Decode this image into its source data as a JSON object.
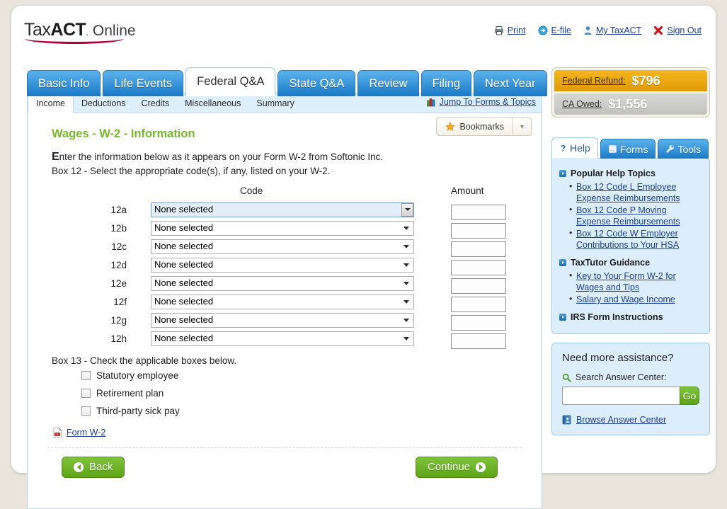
{
  "brand": {
    "logo_tax": "Tax",
    "logo_act": "ACT",
    "logo_online": "Online"
  },
  "top_links": [
    {
      "label": "Print",
      "icon": "printer-icon"
    },
    {
      "label": "E-file",
      "icon": "efile-icon"
    },
    {
      "label": "My TaxACT",
      "icon": "user-icon"
    },
    {
      "label": "Sign Out",
      "icon": "close-x-icon"
    }
  ],
  "tabs": [
    {
      "label": "Basic Info",
      "active": false
    },
    {
      "label": "Life Events",
      "active": false
    },
    {
      "label": "Federal Q&A",
      "active": true
    },
    {
      "label": "State Q&A",
      "active": false
    },
    {
      "label": "Review",
      "active": false
    },
    {
      "label": "Filing",
      "active": false
    },
    {
      "label": "Next Year",
      "active": false
    }
  ],
  "subtabs": [
    {
      "label": "Income",
      "active": true
    },
    {
      "label": "Deductions",
      "active": false
    },
    {
      "label": "Credits",
      "active": false
    },
    {
      "label": "Miscellaneous",
      "active": false
    },
    {
      "label": "Summary",
      "active": false
    }
  ],
  "jump_link": {
    "label": "Jump To Forms & Topics",
    "icon": "books-icon"
  },
  "main": {
    "page_title": "Wages - W-2 - Information",
    "bookmarks_label": "Bookmarks",
    "intro_first_letter": "E",
    "intro_line1_rest": "nter the information below as it appears on your Form W-2 from Softonic Inc.",
    "intro_line2": "Box 12 - Select the appropriate code(s), if any, listed on your W-2.",
    "col_code": "Code",
    "col_amount": "Amount",
    "rows": [
      {
        "label": "12a",
        "code_value": "None selected",
        "amount_value": "",
        "focused": true
      },
      {
        "label": "12b",
        "code_value": "None selected",
        "amount_value": "",
        "focused": false
      },
      {
        "label": "12c",
        "code_value": "None selected",
        "amount_value": "",
        "focused": false
      },
      {
        "label": "12d",
        "code_value": "None selected",
        "amount_value": "",
        "focused": false
      },
      {
        "label": "12e",
        "code_value": "None selected",
        "amount_value": "",
        "focused": false
      },
      {
        "label": "12f",
        "code_value": "None selected",
        "amount_value": "",
        "focused": false
      },
      {
        "label": "12g",
        "code_value": "None selected",
        "amount_value": "",
        "focused": false
      },
      {
        "label": "12h",
        "code_value": "None selected",
        "amount_value": "",
        "focused": false
      }
    ],
    "box13_label": "Box 13 - Check the applicable boxes below.",
    "checkboxes": [
      {
        "label": "Statutory employee",
        "checked": false
      },
      {
        "label": "Retirement plan",
        "checked": false
      },
      {
        "label": "Third-party sick pay",
        "checked": false
      }
    ],
    "form_link": "Form W-2",
    "back_label": "Back",
    "continue_label": "Continue"
  },
  "refund": {
    "federal_label": "Federal Refund:",
    "federal_amount": "$796",
    "state_label": "CA Owed:",
    "state_amount": "$1,556",
    "federal_color": "#e6a50a",
    "state_color": "#c9c9c6"
  },
  "rail_tabs": [
    {
      "label": "Help",
      "icon": "question-icon",
      "active": true
    },
    {
      "label": "Forms",
      "icon": "document-icon",
      "active": false
    },
    {
      "label": "Tools",
      "icon": "wrench-icon",
      "active": false
    }
  ],
  "help": {
    "sections": [
      {
        "title": "Popular Help Topics",
        "links": [
          "Box 12 Code L Employee Expense Reimbursements",
          "Box 12 Code P Moving Expense Reimbursements",
          "Box 12 Code W Employer Contributions to Your HSA"
        ]
      },
      {
        "title": "TaxTutor Guidance",
        "links": [
          "Key to Your Form W-2 for Wages and Tips",
          "Salary and Wage Income"
        ]
      },
      {
        "title": "IRS Form Instructions",
        "links": []
      }
    ]
  },
  "assistance": {
    "title": "Need more assistance?",
    "search_label": "Search Answer Center:",
    "search_value": "",
    "search_placeholder": "",
    "go_label": "Go",
    "browse_label": "Browse Answer Center"
  }
}
